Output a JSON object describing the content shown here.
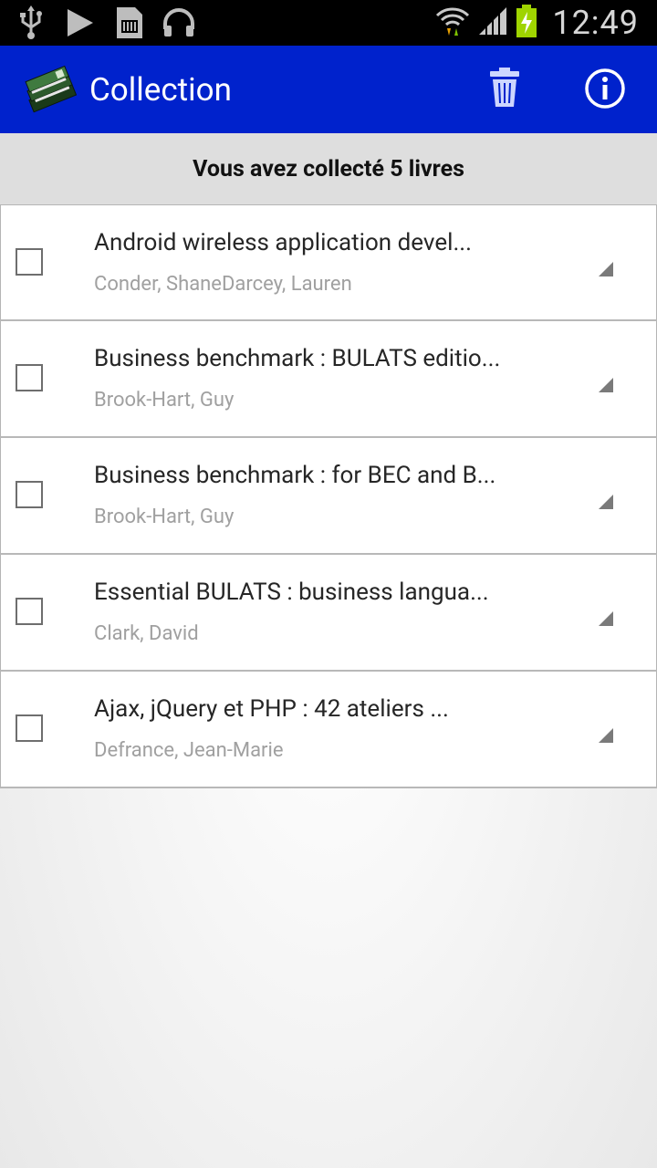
{
  "status_bar": {
    "time": "12:49",
    "left_icons": [
      "usb-icon",
      "play-store-icon",
      "sd-card-icon",
      "headphones-icon"
    ],
    "right_icons": [
      "wifi-icon",
      "signal-icon",
      "battery-charging-icon"
    ]
  },
  "action_bar": {
    "title": "Collection",
    "background": "#0022cc",
    "actions": [
      "trash-icon",
      "info-icon"
    ]
  },
  "header": {
    "count_text": "Vous avez collecté 5 livres"
  },
  "books": [
    {
      "title": "Android wireless application devel...",
      "author": "Conder, ShaneDarcey, Lauren"
    },
    {
      "title": "Business benchmark : BULATS editio...",
      "author": "Brook-Hart, Guy"
    },
    {
      "title": "Business benchmark : for BEC and B...",
      "author": "Brook-Hart, Guy"
    },
    {
      "title": "Essential BULATS : business langua...",
      "author": "Clark, David"
    },
    {
      "title": "Ajax, jQuery et PHP : 42 ateliers ...",
      "author": "Defrance, Jean-Marie"
    }
  ]
}
